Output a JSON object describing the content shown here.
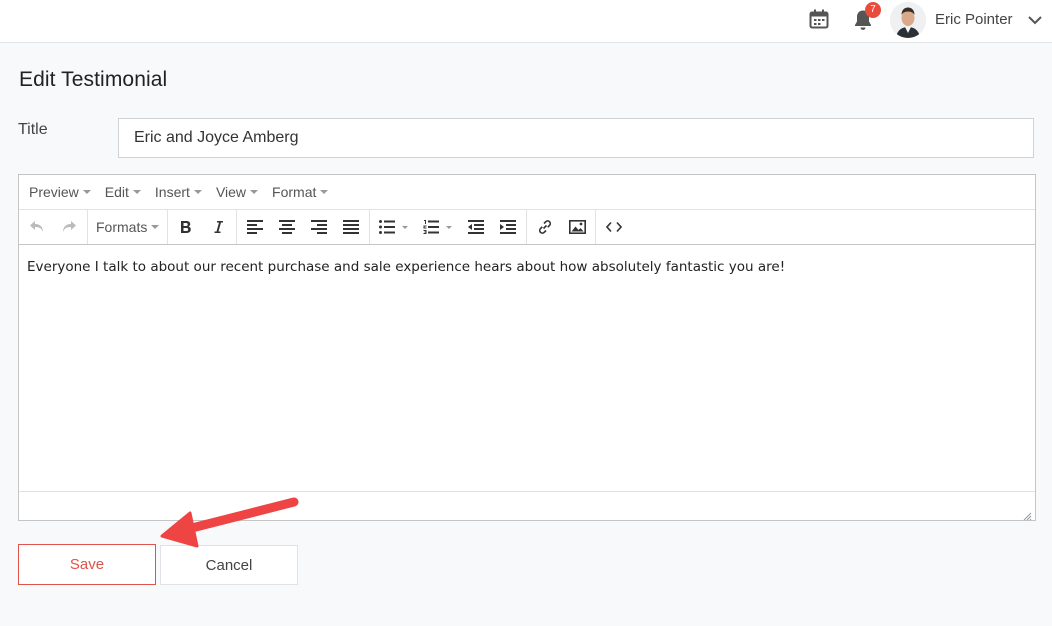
{
  "header": {
    "notification_count": "7",
    "user_name": "Eric Pointer"
  },
  "page": {
    "title": "Edit Testimonial"
  },
  "form": {
    "title_label": "Title",
    "title_value": "Eric and Joyce Amberg"
  },
  "editor": {
    "menu": [
      "Preview",
      "Edit",
      "Insert",
      "View",
      "Format"
    ],
    "formats_label": "Formats",
    "content": "Everyone I talk to about our recent purchase and sale experience hears about how absolutely fantastic you are!"
  },
  "actions": {
    "save_label": "Save",
    "cancel_label": "Cancel"
  },
  "colors": {
    "accent": "#e0534a",
    "badge": "#e74c3c",
    "annotation_arrow": "#ee4444"
  }
}
